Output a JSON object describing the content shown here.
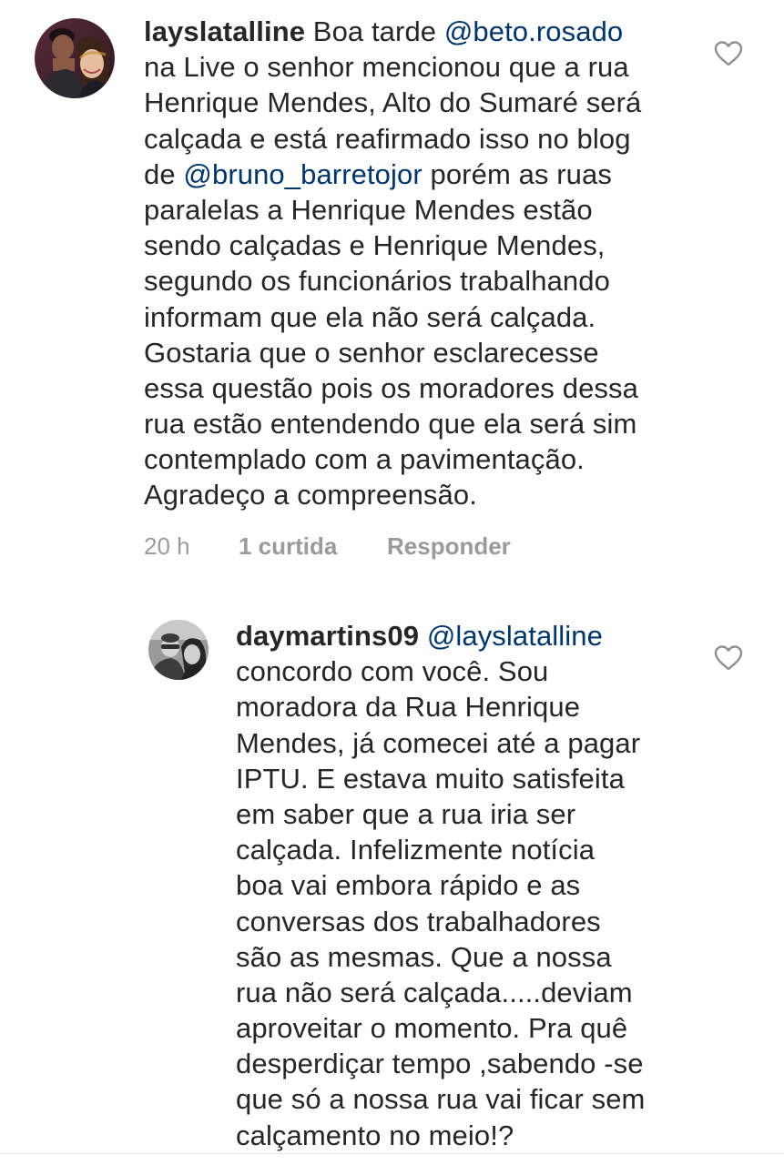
{
  "comments": [
    {
      "username": "layslatalline",
      "lines": [
        [
          {
            "type": "text",
            "value": " Boa tarde "
          },
          {
            "type": "mention",
            "value": "@beto.rosado"
          }
        ],
        [
          {
            "type": "text",
            "value": "na Live o senhor mencionou que a rua"
          }
        ],
        [
          {
            "type": "text",
            "value": "Henrique Mendes, Alto do Sumaré será"
          }
        ],
        [
          {
            "type": "text",
            "value": "calçada e está reafirmado isso no blog"
          }
        ],
        [
          {
            "type": "text",
            "value": "de "
          },
          {
            "type": "mention",
            "value": "@bruno_barretojor"
          },
          {
            "type": "text",
            "value": " porém as ruas"
          }
        ],
        [
          {
            "type": "text",
            "value": "paralelas a Henrique Mendes estão"
          }
        ],
        [
          {
            "type": "text",
            "value": "sendo calçadas e Henrique Mendes,"
          }
        ],
        [
          {
            "type": "text",
            "value": "segundo os funcionários trabalhando"
          }
        ],
        [
          {
            "type": "text",
            "value": "informam que ela não será calçada."
          }
        ],
        [
          {
            "type": "text",
            "value": "Gostaria que o senhor esclarecesse"
          }
        ],
        [
          {
            "type": "text",
            "value": "essa questão pois os moradores dessa"
          }
        ],
        [
          {
            "type": "text",
            "value": "rua estão entendendo que ela será sim"
          }
        ],
        [
          {
            "type": "text",
            "value": "contemplado com a pavimentação."
          }
        ],
        [
          {
            "type": "text",
            "value": "Agradeço a compreensão."
          }
        ]
      ],
      "time": "20 h",
      "likes": "1 curtida",
      "reply": "Responder",
      "like_icon": "heart-outline-icon",
      "avatar_icon": "profile-photo-couple"
    },
    {
      "username": "daymartins09",
      "lines": [
        [
          {
            "type": "text",
            "value": " "
          },
          {
            "type": "mention",
            "value": "@layslatalline"
          }
        ],
        [
          {
            "type": "text",
            "value": "concordo com você. Sou"
          }
        ],
        [
          {
            "type": "text",
            "value": "moradora da Rua Henrique"
          }
        ],
        [
          {
            "type": "text",
            "value": "Mendes, já comecei até a pagar"
          }
        ],
        [
          {
            "type": "text",
            "value": "IPTU. E estava muito satisfeita"
          }
        ],
        [
          {
            "type": "text",
            "value": "em saber que a rua iria ser"
          }
        ],
        [
          {
            "type": "text",
            "value": "calçada. Infelizmente notícia"
          }
        ],
        [
          {
            "type": "text",
            "value": "boa vai embora rápido e as"
          }
        ],
        [
          {
            "type": "text",
            "value": "conversas dos trabalhadores"
          }
        ],
        [
          {
            "type": "text",
            "value": "são as mesmas. Que a nossa"
          }
        ],
        [
          {
            "type": "text",
            "value": "rua não será calçada.....deviam"
          }
        ],
        [
          {
            "type": "text",
            "value": "aproveitar o momento.  Pra quê"
          }
        ],
        [
          {
            "type": "text",
            "value": "desperdiçar tempo ,sabendo -se"
          }
        ],
        [
          {
            "type": "text",
            "value": "que só a nossa rua vai ficar sem"
          }
        ],
        [
          {
            "type": "text",
            "value": "calçamento no meio!?"
          }
        ]
      ],
      "like_icon": "heart-outline-icon",
      "avatar_icon": "profile-photo-grayscale"
    }
  ],
  "colors": {
    "text": "#262626",
    "mention": "#003569",
    "meta": "#9a9a9a",
    "icon": "#8e8e8e"
  }
}
